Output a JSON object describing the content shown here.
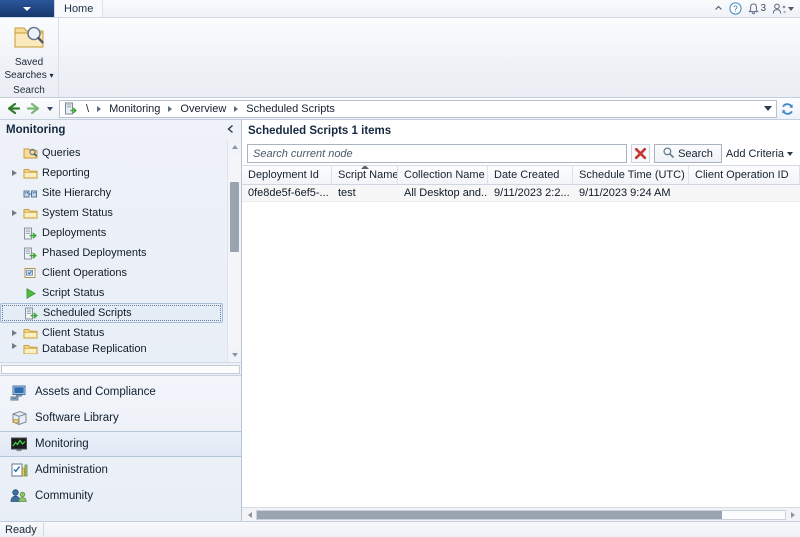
{
  "window": {
    "app_menu_label": "Application Menu",
    "tabs": [
      {
        "label": "Home"
      }
    ],
    "title_right": {
      "minimize_ribbon": "chevron-up-icon",
      "help": "?",
      "notifications_count": "3"
    }
  },
  "ribbon": {
    "groups": [
      {
        "button_line1": "Saved",
        "button_line2": "Searches",
        "dropdown_glyph": "▾",
        "group_label": "Search",
        "icon": "saved-searches-icon"
      }
    ]
  },
  "addressbar": {
    "back_label": "Back",
    "forward_label": "Forward",
    "history_label": "Recent locations",
    "root_crumb": "\\",
    "crumbs": [
      "Monitoring",
      "Overview",
      "Scheduled Scripts"
    ],
    "dropdown_label": "Previous Locations",
    "refresh_label": "Refresh"
  },
  "navpane": {
    "header": "Monitoring",
    "collapse_label": "Collapse pane",
    "tree": [
      {
        "label": "Queries",
        "icon": "queries-icon",
        "expandable": false,
        "selected": false
      },
      {
        "label": "Reporting",
        "icon": "folder-icon",
        "expandable": true,
        "selected": false
      },
      {
        "label": "Site Hierarchy",
        "icon": "site-hierarchy-icon",
        "expandable": false,
        "selected": false
      },
      {
        "label": "System Status",
        "icon": "folder-icon",
        "expandable": true,
        "selected": false
      },
      {
        "label": "Deployments",
        "icon": "deployment-icon",
        "expandable": false,
        "selected": false
      },
      {
        "label": "Phased Deployments",
        "icon": "deployment-icon",
        "expandable": false,
        "selected": false
      },
      {
        "label": "Client Operations",
        "icon": "client-operations-icon",
        "expandable": false,
        "selected": false
      },
      {
        "label": "Script Status",
        "icon": "script-status-icon",
        "expandable": false,
        "selected": false
      },
      {
        "label": "Scheduled Scripts",
        "icon": "deployment-icon",
        "expandable": false,
        "selected": true
      },
      {
        "label": "Client Status",
        "icon": "folder-icon",
        "expandable": true,
        "selected": false
      },
      {
        "label": "Database Replication",
        "icon": "folder-icon",
        "expandable": true,
        "selected": false
      }
    ],
    "workspaces": [
      {
        "label": "Assets and Compliance",
        "icon": "assets-icon",
        "selected": false
      },
      {
        "label": "Software Library",
        "icon": "software-icon",
        "selected": false
      },
      {
        "label": "Monitoring",
        "icon": "monitoring-icon",
        "selected": true
      },
      {
        "label": "Administration",
        "icon": "administration-icon",
        "selected": false
      },
      {
        "label": "Community",
        "icon": "community-icon",
        "selected": false
      }
    ]
  },
  "content": {
    "header": "Scheduled Scripts 1 items",
    "search": {
      "placeholder": "Search current node",
      "value": "",
      "clear_label": "Clear search",
      "search_button": "Search",
      "add_criteria": "Add Criteria",
      "add_criteria_caret": "▾"
    },
    "grid": {
      "columns": [
        {
          "label": "Deployment Id",
          "width": 90,
          "sorted": false
        },
        {
          "label": "Script Name",
          "width": 66,
          "sorted": true
        },
        {
          "label": "Collection Name",
          "width": 90,
          "sorted": false
        },
        {
          "label": "Date Created",
          "width": 85,
          "sorted": false
        },
        {
          "label": "Schedule Time (UTC)",
          "width": 116,
          "sorted": false
        },
        {
          "label": "Client Operation ID",
          "width": 110,
          "sorted": false
        }
      ],
      "rows": [
        {
          "cells": [
            "0fe8de5f-6ef5-...",
            "test",
            "All Desktop and...",
            "9/11/2023 2:2...",
            "9/11/2023 9:24 AM",
            ""
          ]
        }
      ]
    }
  },
  "statusbar": {
    "text": "Ready"
  },
  "colors": {
    "app_menu_blue": "#16386e",
    "accent_green": "#3fa535",
    "folder_yellow": "#f5d98a",
    "clear_red": "#c8342c",
    "selection_blue": "#e4ecf6",
    "pane_bg": "#eff3f9"
  }
}
